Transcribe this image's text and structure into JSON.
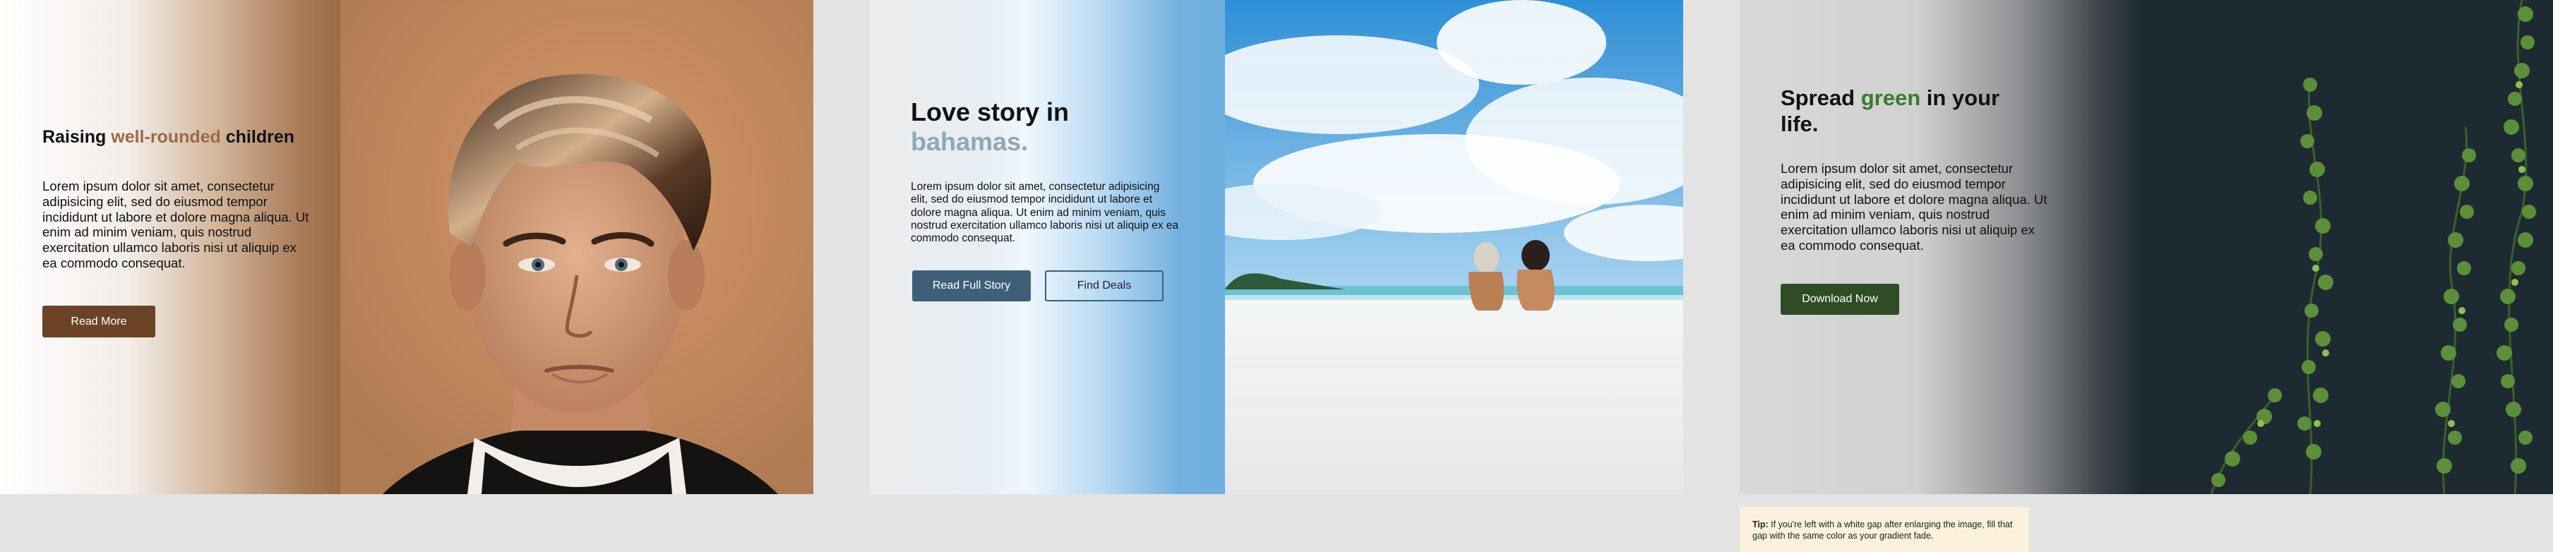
{
  "panel1": {
    "heading_pre": "Raising ",
    "heading_accent": "well-rounded",
    "heading_post": " children",
    "accent_color": "#9b6a48",
    "body": "Lorem ipsum dolor sit amet, consectetur adipisicing elit, sed do eiusmod tempor incididunt ut labore et dolore magna aliqua. Ut enim ad minim veniam, quis nostrud exercitation ullamco laboris nisi ut aliquip ex ea commodo consequat.",
    "button_label": "Read More",
    "button_color": "#6b4428"
  },
  "panel2": {
    "heading_line1": "Love story in",
    "heading_line2": "bahamas.",
    "accent_color": "#8fa7ba",
    "body": "Lorem ipsum dolor sit amet, consectetur adipisicing elit, sed do eiusmod tempor incididunt ut labore et dolore magna aliqua. Ut enim ad minim veniam, quis nostrud exercitation ullamco laboris nisi ut aliquip ex ea commodo consequat.",
    "primary_button_label": "Read Full Story",
    "secondary_button_label": "Find Deals",
    "button_color": "#3f5f79"
  },
  "panel3": {
    "heading_pre": "Spread ",
    "heading_accent": "green",
    "heading_post": " in your life.",
    "accent_color": "#3a7a2e",
    "body": "Lorem ipsum dolor sit amet, consectetur adipisicing elit, sed do eiusmod tempor incididunt ut labore et dolore magna aliqua. Ut enim ad minim veniam, quis nostrud exercitation ullamco laboris nisi ut aliquip ex ea commodo consequat.",
    "button_label": "Download Now",
    "button_color": "#2e4d26"
  },
  "tip": {
    "label": "Tip:",
    "text": " If you're left with a white gap after enlarging the image, fill that gap with the same color as your gradient fade."
  }
}
